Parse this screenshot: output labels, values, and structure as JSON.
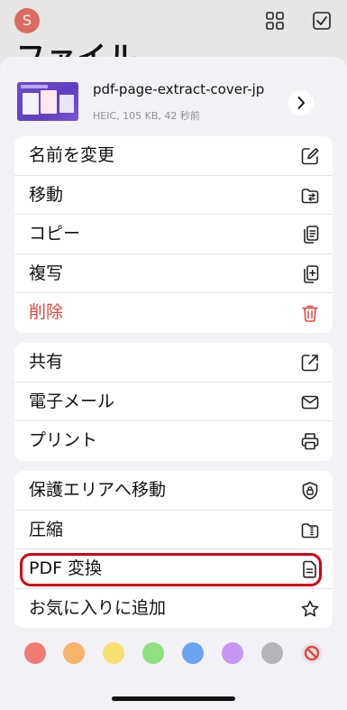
{
  "background": {
    "avatar_letter": "S",
    "title": "ファイル"
  },
  "file": {
    "name": "pdf-page-extract-cover-jp",
    "meta": "HEIC, 105 KB, 42 秒前"
  },
  "group1": [
    {
      "label": "名前を変更",
      "icon": "rename-icon"
    },
    {
      "label": "移動",
      "icon": "move-folder-icon"
    },
    {
      "label": "コピー",
      "icon": "copy-icon"
    },
    {
      "label": "複写",
      "icon": "duplicate-icon"
    },
    {
      "label": "削除",
      "icon": "trash-icon"
    }
  ],
  "group2": [
    {
      "label": "共有",
      "icon": "share-icon"
    },
    {
      "label": "電子メール",
      "icon": "mail-icon"
    },
    {
      "label": "プリント",
      "icon": "printer-icon"
    }
  ],
  "group3": [
    {
      "label": "保護エリアへ移動",
      "icon": "shield-lock-icon"
    },
    {
      "label": "圧縮",
      "icon": "zip-folder-icon"
    },
    {
      "label": "PDF 変換",
      "icon": "document-icon"
    },
    {
      "label": "お気に入りに追加",
      "icon": "star-icon"
    }
  ],
  "colors": {
    "red": "#ef7b73",
    "orange": "#f5b468",
    "yellow": "#f8df6f",
    "green": "#8fe07f",
    "blue": "#6aa3ef",
    "purple": "#c896f2",
    "gray": "#b5b5b8",
    "delete_accent": "#e5433a",
    "highlight": "#d40012"
  }
}
